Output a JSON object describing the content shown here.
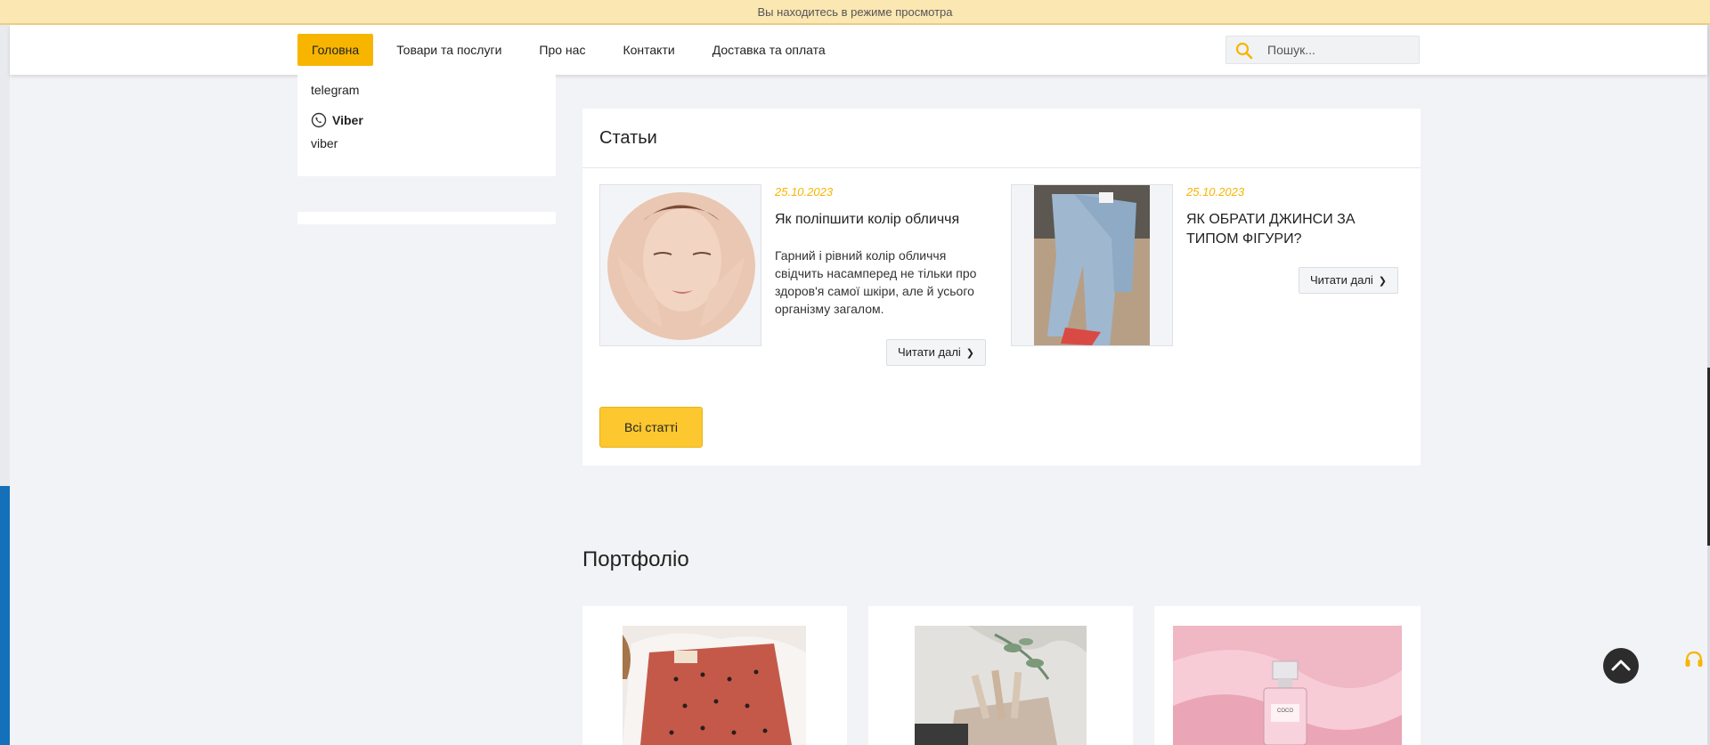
{
  "preview_bar": {
    "text": "Вы находитесь в режиме просмотра"
  },
  "nav": {
    "items": [
      {
        "label": "Головна"
      },
      {
        "label": "Товари та послуги"
      },
      {
        "label": "Про нас"
      },
      {
        "label": "Контакти"
      },
      {
        "label": "Доставка та оплата"
      }
    ]
  },
  "search": {
    "placeholder": "Пошук...",
    "icon": "search-icon"
  },
  "sidebar": {
    "telegram_value": "telegram",
    "viber_label": "Viber",
    "viber_value": "viber"
  },
  "articles": {
    "title": "Статьи",
    "items": [
      {
        "date": "25.10.2023",
        "title": "Як поліпшити колір обличчя",
        "description": "Гарний і рівний колір обличчя свідчить насамперед не тільки про здоров'я самої шкіри, але й усього організму загалом.",
        "read_more": "Читати далі"
      },
      {
        "date": "25.10.2023",
        "title": "ЯК ОБРАТИ ДЖИНСИ ЗА ТИПОМ ФІГУРИ?",
        "description": "",
        "read_more": "Читати далі"
      }
    ],
    "all_button": "Всі статті"
  },
  "portfolio": {
    "title": "Портфоліо"
  },
  "colors": {
    "accent": "#f7b500",
    "button_yellow": "#fcc72f",
    "date": "#f7b500"
  }
}
